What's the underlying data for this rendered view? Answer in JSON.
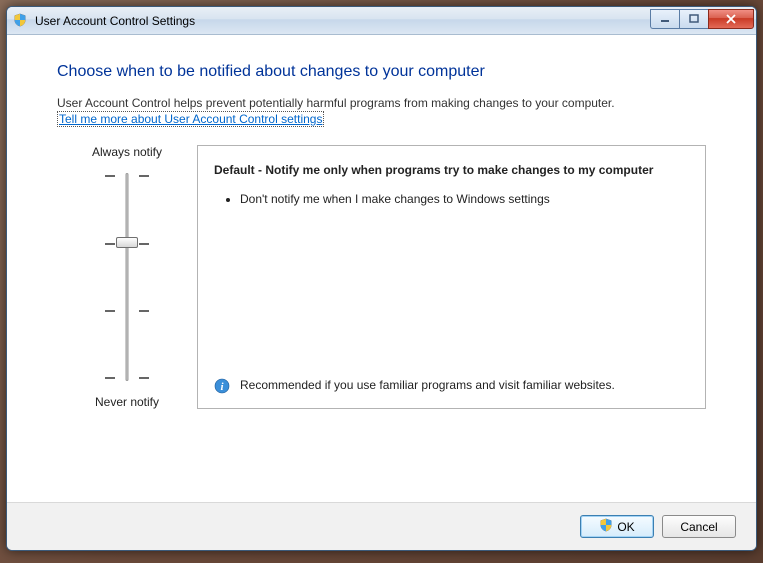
{
  "window": {
    "title": "User Account Control Settings"
  },
  "main": {
    "heading": "Choose when to be notified about changes to your computer",
    "description": "User Account Control helps prevent potentially harmful programs from making changes to your computer.",
    "link": "Tell me more about User Account Control settings"
  },
  "slider": {
    "top_label": "Always notify",
    "bottom_label": "Never notify"
  },
  "panel": {
    "title": "Default - Notify me only when programs try to make changes to my computer",
    "bullet1": "Don't notify me when I make changes to Windows settings",
    "recommendation": "Recommended if you use familiar programs and visit familiar websites."
  },
  "buttons": {
    "ok": "OK",
    "cancel": "Cancel"
  }
}
